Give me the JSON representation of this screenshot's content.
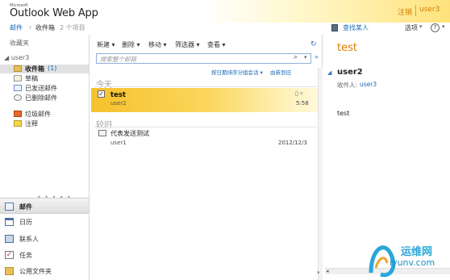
{
  "header": {
    "brand_small": "Microsoft",
    "brand": "Outlook Web App",
    "signout": "注销",
    "user": "user3"
  },
  "breadcrumb": {
    "mail": "邮件",
    "arrow": "›",
    "inbox": "收件箱",
    "count": "2 个项目",
    "find_people": "查找某人",
    "options": "选项",
    "options_chevron": "▾",
    "help": "?",
    "help_chevron": "▾"
  },
  "nav": {
    "favorites": "收藏夹",
    "tree_user": "◢ user3",
    "folders": {
      "inbox": "收件箱",
      "inbox_count": "(1)",
      "drafts": "草稿",
      "sent": "已发送邮件",
      "deleted": "已删除邮件",
      "junk": "垃圾邮件",
      "notes": "注释"
    },
    "dots": "• • • • •",
    "modules": {
      "mail": "邮件",
      "calendar": "日历",
      "contacts": "联系人",
      "tasks": "任务",
      "public": "公用文件夹"
    }
  },
  "toolbar": {
    "new": "新建 ▾",
    "delete": "删除 ▾",
    "move": "移动 ▾",
    "filter": "筛选器 ▾",
    "view": "查看 ▾",
    "refresh": "↻"
  },
  "search": {
    "placeholder": "搜索整个邮箱",
    "icon": "⌕",
    "chevron": "▾",
    "expand": "»"
  },
  "sort": {
    "label": "按日期排序分组会话 ▾",
    "order": "由新到旧"
  },
  "groups": {
    "today": "今天",
    "older": "较旧"
  },
  "messages": [
    {
      "subject": "test",
      "sender": "user2",
      "time": "5:58",
      "icons": "▯ ▿",
      "check": "✓"
    },
    {
      "subject": "代表发送测试",
      "sender": "user1",
      "time": "2012/12/3"
    }
  ],
  "reading": {
    "subject": "test",
    "collapse": "◢",
    "sender": "user2",
    "to_label": "收件人:",
    "to_user": "user3",
    "body": "test"
  },
  "scroll": {
    "down": "▾",
    "left": "◂"
  },
  "watermark": {
    "name": "运维网",
    "url": "iyunv.com"
  },
  "colors": {
    "accent_orange": "#e07b00",
    "link_blue": "#1a6bb8",
    "selected_yellow": "#f5c22d"
  }
}
